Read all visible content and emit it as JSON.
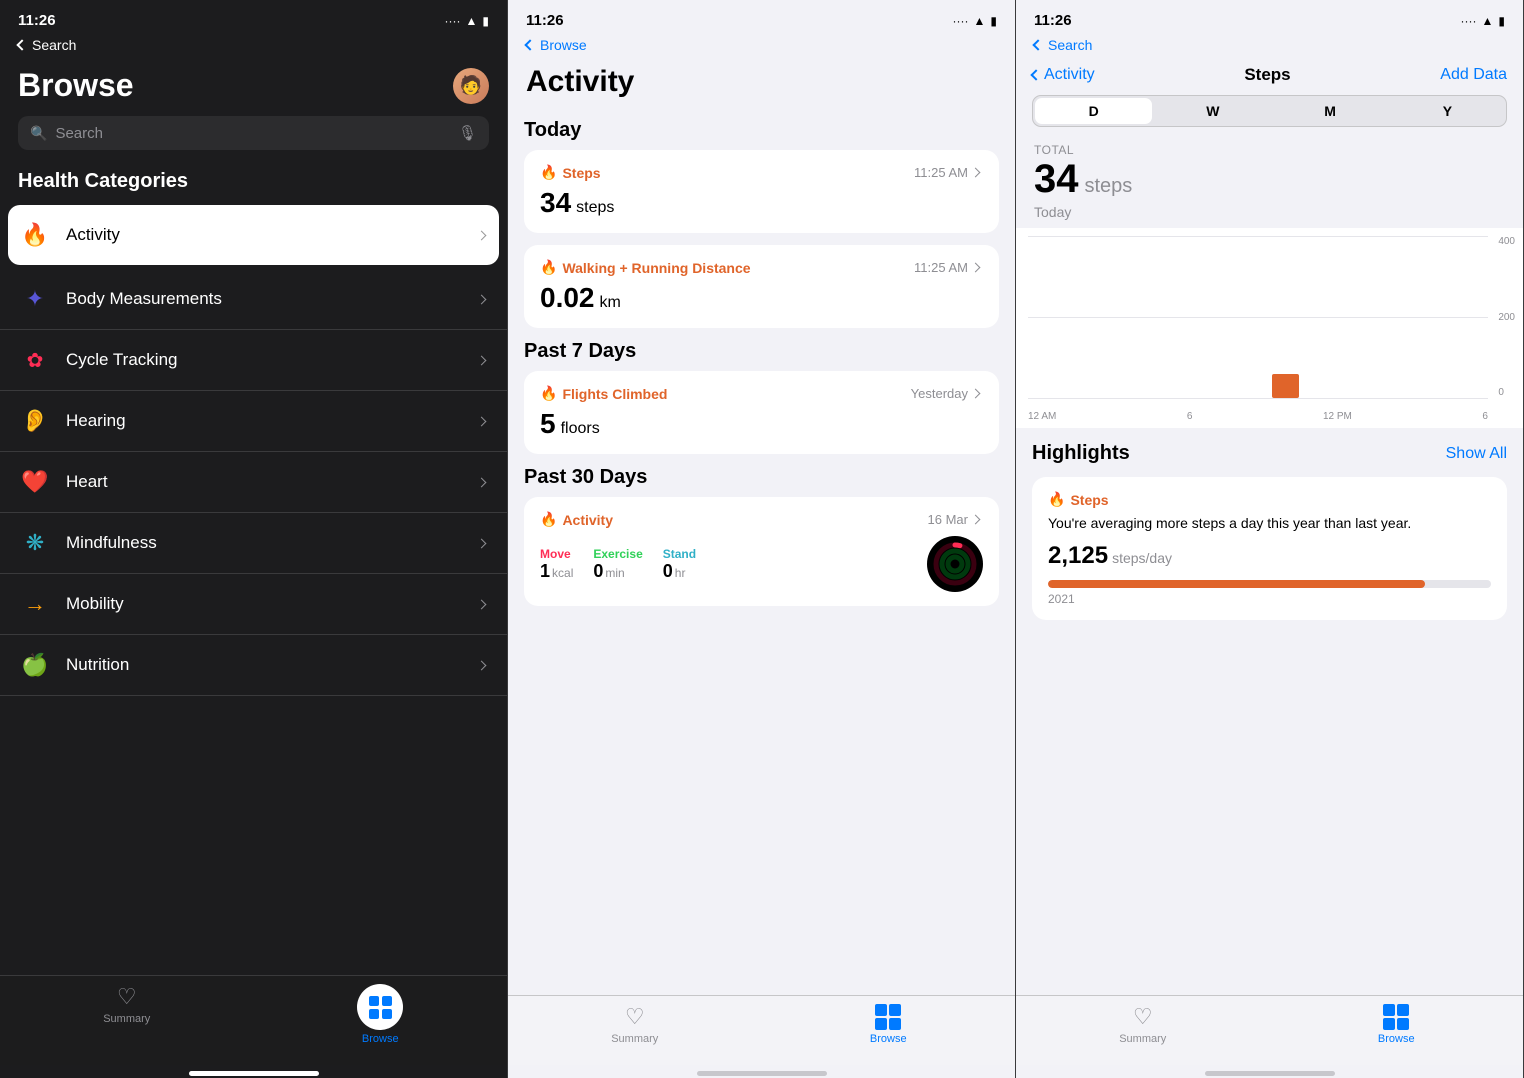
{
  "panel1": {
    "statusBar": {
      "time": "11:26",
      "backLabel": "Search"
    },
    "title": "Browse",
    "searchPlaceholder": "Search",
    "sectionTitle": "Health Categories",
    "categories": [
      {
        "id": "activity",
        "label": "Activity",
        "icon": "🔥",
        "active": true
      },
      {
        "id": "body",
        "label": "Body Measurements",
        "icon": "🧘"
      },
      {
        "id": "cycle",
        "label": "Cycle Tracking",
        "icon": "🌸"
      },
      {
        "id": "hearing",
        "label": "Hearing",
        "icon": "👂"
      },
      {
        "id": "heart",
        "label": "Heart",
        "icon": "❤️"
      },
      {
        "id": "mindfulness",
        "label": "Mindfulness",
        "icon": "🧠"
      },
      {
        "id": "mobility",
        "label": "Mobility",
        "icon": "➡️"
      },
      {
        "id": "nutrition",
        "label": "Nutrition",
        "icon": "🍎"
      }
    ],
    "tabs": [
      {
        "id": "summary",
        "label": "Summary",
        "active": false
      },
      {
        "id": "browse",
        "label": "Browse",
        "active": true
      }
    ]
  },
  "panel2": {
    "statusBar": {
      "time": "11:26",
      "backLabel": "Browse"
    },
    "title": "Activity",
    "sections": {
      "today": {
        "label": "Today",
        "cards": [
          {
            "id": "steps",
            "title": "Steps",
            "time": "11:25 AM",
            "value": "34",
            "unit": "steps"
          },
          {
            "id": "walking",
            "title": "Walking + Running Distance",
            "time": "11:25 AM",
            "value": "0.02",
            "unit": "km"
          }
        ]
      },
      "past7": {
        "label": "Past 7 Days",
        "cards": [
          {
            "id": "flights",
            "title": "Flights Climbed",
            "time": "Yesterday",
            "value": "5",
            "unit": "floors"
          }
        ]
      },
      "past30": {
        "label": "Past 30 Days",
        "cards": [
          {
            "id": "activity30",
            "title": "Activity",
            "time": "16 Mar",
            "move": {
              "label": "Move",
              "value": "1",
              "unit": "kcal"
            },
            "exercise": {
              "label": "Exercise",
              "value": "0",
              "unit": "min"
            },
            "stand": {
              "label": "Stand",
              "value": "0",
              "unit": "hr"
            }
          }
        ]
      }
    },
    "tabs": [
      {
        "id": "summary",
        "label": "Summary",
        "active": false
      },
      {
        "id": "browse",
        "label": "Browse",
        "active": true
      }
    ]
  },
  "panel3": {
    "statusBar": {
      "time": "11:26",
      "backLabel": "Search"
    },
    "nav": {
      "backLabel": "Activity",
      "title": "Steps",
      "actionLabel": "Add Data"
    },
    "periodSelector": {
      "options": [
        "D",
        "W",
        "M",
        "Y"
      ],
      "selected": "D"
    },
    "total": {
      "label": "TOTAL",
      "value": "34",
      "unit": "steps",
      "date": "Today"
    },
    "chart": {
      "xLabels": [
        "12 AM",
        "6",
        "12 PM",
        "6"
      ],
      "yLabels": [
        "400",
        "200",
        "0"
      ],
      "barPosition": 55,
      "barHeight": 40
    },
    "highlights": {
      "title": "Highlights",
      "showAllLabel": "Show All",
      "card": {
        "title": "Steps",
        "description": "You're averaging more steps a day this year than last year.",
        "value": "2,125",
        "unit": "steps/day",
        "barPercent": 85,
        "yearLabel": "2021"
      }
    },
    "tabs": [
      {
        "id": "summary",
        "label": "Summary",
        "active": false
      },
      {
        "id": "browse",
        "label": "Browse",
        "active": true
      }
    ]
  },
  "icons": {
    "flame": "🔥",
    "heart": "♡",
    "grid": "⊞"
  }
}
